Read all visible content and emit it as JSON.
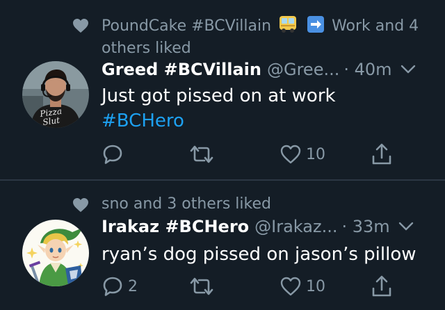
{
  "tweets": [
    {
      "social_context": {
        "prefix": "PoundCake #BCVillain",
        "suffix": "Work and 4 others liked",
        "emoji": [
          "bus-emoji",
          "right-arrow-emoji"
        ]
      },
      "author": {
        "name": "Greed #BCVillain",
        "handle": "@Gree...",
        "time": "· 40m"
      },
      "text": "Just got pissed on at work",
      "hashtag": "#BCHero",
      "actions": {
        "reply_count": "",
        "retweet_count": "",
        "like_count": "10"
      },
      "avatar_shirt_text": [
        "Pizza",
        "Slut"
      ]
    },
    {
      "social_context": {
        "prefix": "sno and 3 others liked",
        "suffix": "",
        "emoji": []
      },
      "author": {
        "name": "Irakaz #BCHero",
        "handle": "@Irakaz...",
        "time": "· 33m"
      },
      "text": "ryan’s dog pissed on jason’s pillow",
      "hashtag": "",
      "actions": {
        "reply_count": "2",
        "retweet_count": "",
        "like_count": "10"
      }
    }
  ],
  "colors": {
    "background": "#141d26",
    "divider": "#2c3744",
    "secondary_text": "#8899a6",
    "primary_text": "#ffffff",
    "accent": "#1da1f2",
    "icon": "#8899a6"
  },
  "icons": {
    "liked": "heart-filled-icon",
    "reply": "reply-bubble-icon",
    "retweet": "retweet-icon",
    "like": "heart-outline-icon",
    "share": "share-icon",
    "menu": "chevron-down-icon"
  }
}
